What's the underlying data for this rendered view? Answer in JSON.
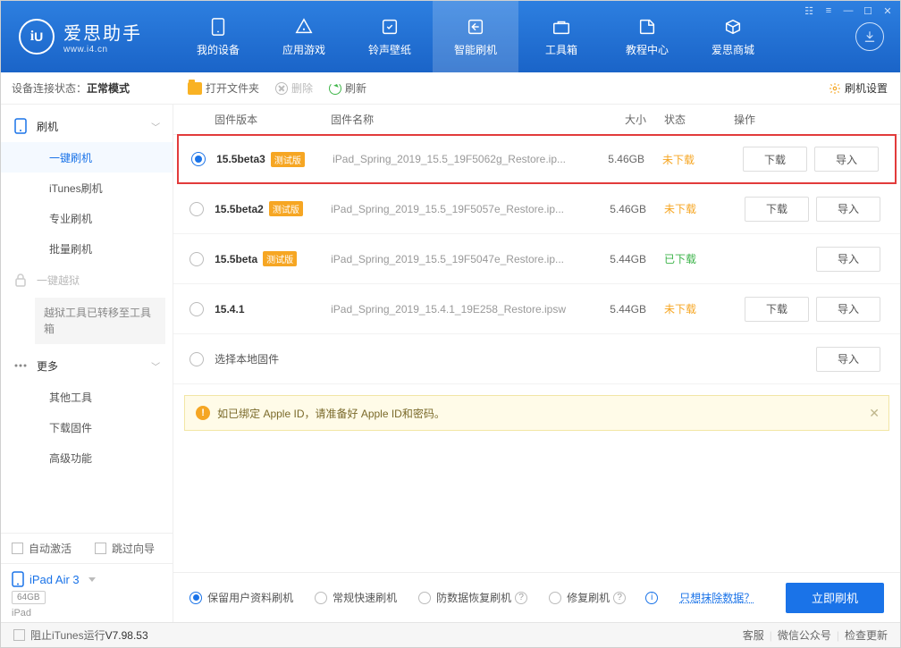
{
  "brand": {
    "name": "爱思助手",
    "url": "www.i4.cn"
  },
  "nav": {
    "items": [
      {
        "label": "我的设备"
      },
      {
        "label": "应用游戏"
      },
      {
        "label": "铃声壁纸"
      },
      {
        "label": "智能刷机"
      },
      {
        "label": "工具箱"
      },
      {
        "label": "教程中心"
      },
      {
        "label": "爱思商城"
      }
    ],
    "active_index": 3
  },
  "sidebar_top": {
    "prefix": "设备连接状态：",
    "value": "正常模式"
  },
  "toolbar": {
    "open_folder": "打开文件夹",
    "delete": "删除",
    "refresh": "刷新",
    "settings": "刷机设置"
  },
  "tree": {
    "flash": "刷机",
    "children": {
      "one_key": "一键刷机",
      "itunes": "iTunes刷机",
      "pro": "专业刷机",
      "batch": "批量刷机"
    },
    "jailbreak": "一键越狱",
    "jailbreak_note": "越狱工具已转移至工具箱",
    "more": "更多",
    "more_children": {
      "other_tools": "其他工具",
      "download_fw": "下载固件",
      "advanced": "高级功能"
    }
  },
  "side_checks": {
    "auto_activate": "自动激活",
    "skip_guide": "跳过向导"
  },
  "device": {
    "name": "iPad Air 3",
    "storage": "64GB",
    "type": "iPad"
  },
  "columns": {
    "version": "固件版本",
    "name": "固件名称",
    "size": "大小",
    "status": "状态",
    "action": "操作"
  },
  "badge_beta": "测试版",
  "status_labels": {
    "not_downloaded": "未下载",
    "downloaded": "已下载"
  },
  "actions": {
    "download": "下载",
    "import": "导入"
  },
  "rows": [
    {
      "sel": true,
      "version": "15.5beta3",
      "beta": true,
      "file": "iPad_Spring_2019_15.5_19F5062g_Restore.ip...",
      "size": "5.46GB",
      "status": "not_downloaded",
      "show_download": true
    },
    {
      "sel": false,
      "version": "15.5beta2",
      "beta": true,
      "file": "iPad_Spring_2019_15.5_19F5057e_Restore.ip...",
      "size": "5.46GB",
      "status": "not_downloaded",
      "show_download": true
    },
    {
      "sel": false,
      "version": "15.5beta",
      "beta": true,
      "file": "iPad_Spring_2019_15.5_19F5047e_Restore.ip...",
      "size": "5.44GB",
      "status": "downloaded",
      "show_download": false
    },
    {
      "sel": false,
      "version": "15.4.1",
      "beta": false,
      "file": "iPad_Spring_2019_15.4.1_19E258_Restore.ipsw",
      "size": "5.44GB",
      "status": "not_downloaded",
      "show_download": true
    }
  ],
  "local_row": "选择本地固件",
  "notice": "如已绑定 Apple ID，请准备好 Apple ID和密码。",
  "modes": {
    "keep_data": "保留用户资料刷机",
    "normal": "常规快速刷机",
    "anti_recovery": "防数据恢复刷机",
    "repair": "修复刷机",
    "erase_link": "只想抹除数据？"
  },
  "primary_action": "立即刷机",
  "footer": {
    "block_itunes": "阻止iTunes运行",
    "version": "V7.98.53",
    "support": "客服",
    "wechat": "微信公众号",
    "update": "检查更新"
  }
}
